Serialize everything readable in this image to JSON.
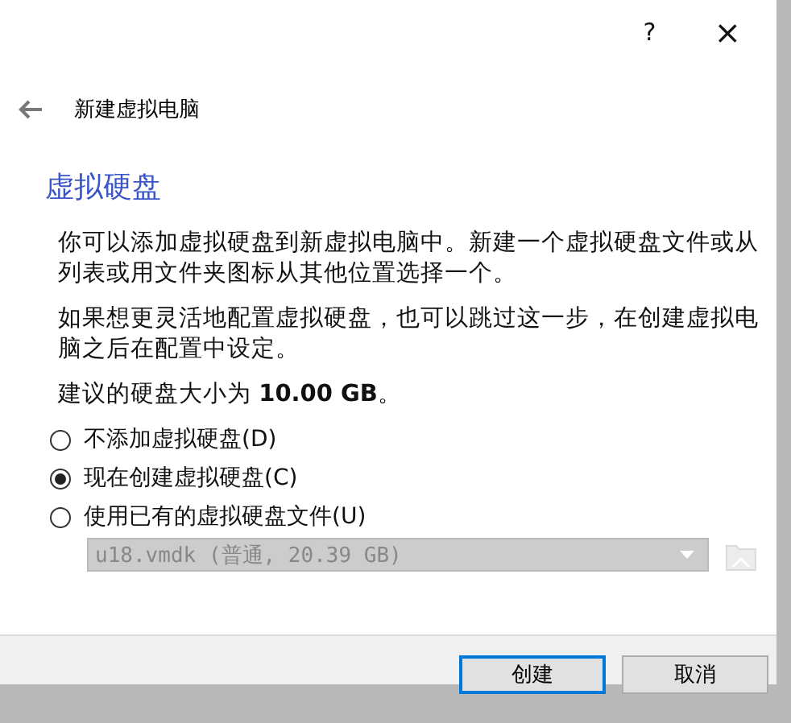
{
  "window": {
    "help": "?",
    "close": "×"
  },
  "header": {
    "title": "新建虚拟电脑"
  },
  "page": {
    "heading": "虚拟硬盘",
    "paragraphs": [
      "你可以添加虚拟硬盘到新虚拟电脑中。新建一个虚拟硬盘文件或从列表或用文件夹图标从其他位置选择一个。",
      "如果想更灵活地配置虚拟硬盘，也可以跳过这一步，在创建虚拟电脑之后在配置中设定。",
      "建议的硬盘大小为 **10.00 GB**。"
    ],
    "options": [
      {
        "label": "不添加虚拟硬盘(D)",
        "selected": false
      },
      {
        "label": "现在创建虚拟硬盘(C)",
        "selected": true
      },
      {
        "label": "使用已有的虚拟硬盘文件(U)",
        "selected": false
      }
    ],
    "disk_select": {
      "value": "u18.vmdk (普通, 20.39 GB)",
      "disabled": true
    }
  },
  "buttons": [
    {
      "label": "创建",
      "default": true
    },
    {
      "label": "取消",
      "default": false
    }
  ]
}
